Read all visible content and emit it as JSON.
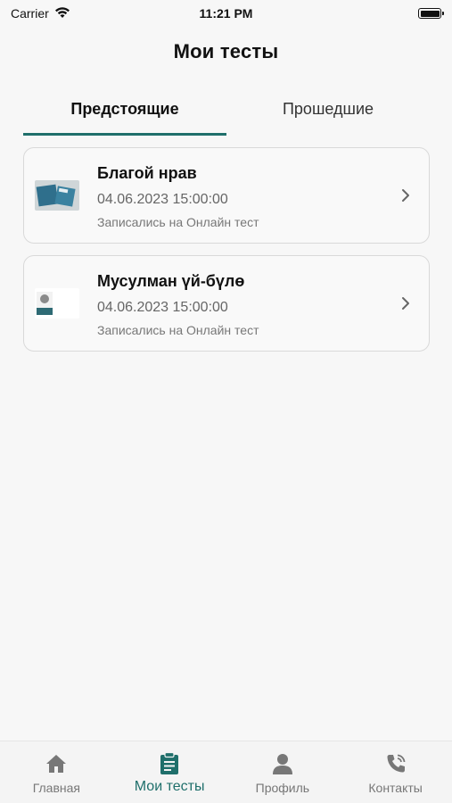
{
  "status_bar": {
    "carrier": "Carrier",
    "time": "11:21 PM",
    "icons": [
      "wifi-icon",
      "battery-icon"
    ]
  },
  "header": {
    "title": "Мои тесты"
  },
  "tabs": [
    {
      "label": "Предстоящие",
      "active": true
    },
    {
      "label": "Прошедшие",
      "active": false
    }
  ],
  "tests": [
    {
      "title": "Благой нрав",
      "date": "04.06.2023 15:00:00",
      "status": "Записались на Онлайн тест",
      "icon": "chevron-right-icon"
    },
    {
      "title": "Мусулман үй-бүлө",
      "date": "04.06.2023 15:00:00",
      "status": "Записались на Онлайн тест",
      "icon": "chevron-right-icon"
    }
  ],
  "bottom_nav": [
    {
      "label": "Главная",
      "icon": "home-icon",
      "active": false
    },
    {
      "label": "Мои тесты",
      "icon": "clipboard-icon",
      "active": true
    },
    {
      "label": "Профиль",
      "icon": "user-icon",
      "active": false
    },
    {
      "label": "Контакты",
      "icon": "phone-icon",
      "active": false
    }
  ],
  "colors": {
    "accent": "#1f6f6b",
    "background": "#f7f7f7",
    "icon_gray": "#777777"
  }
}
